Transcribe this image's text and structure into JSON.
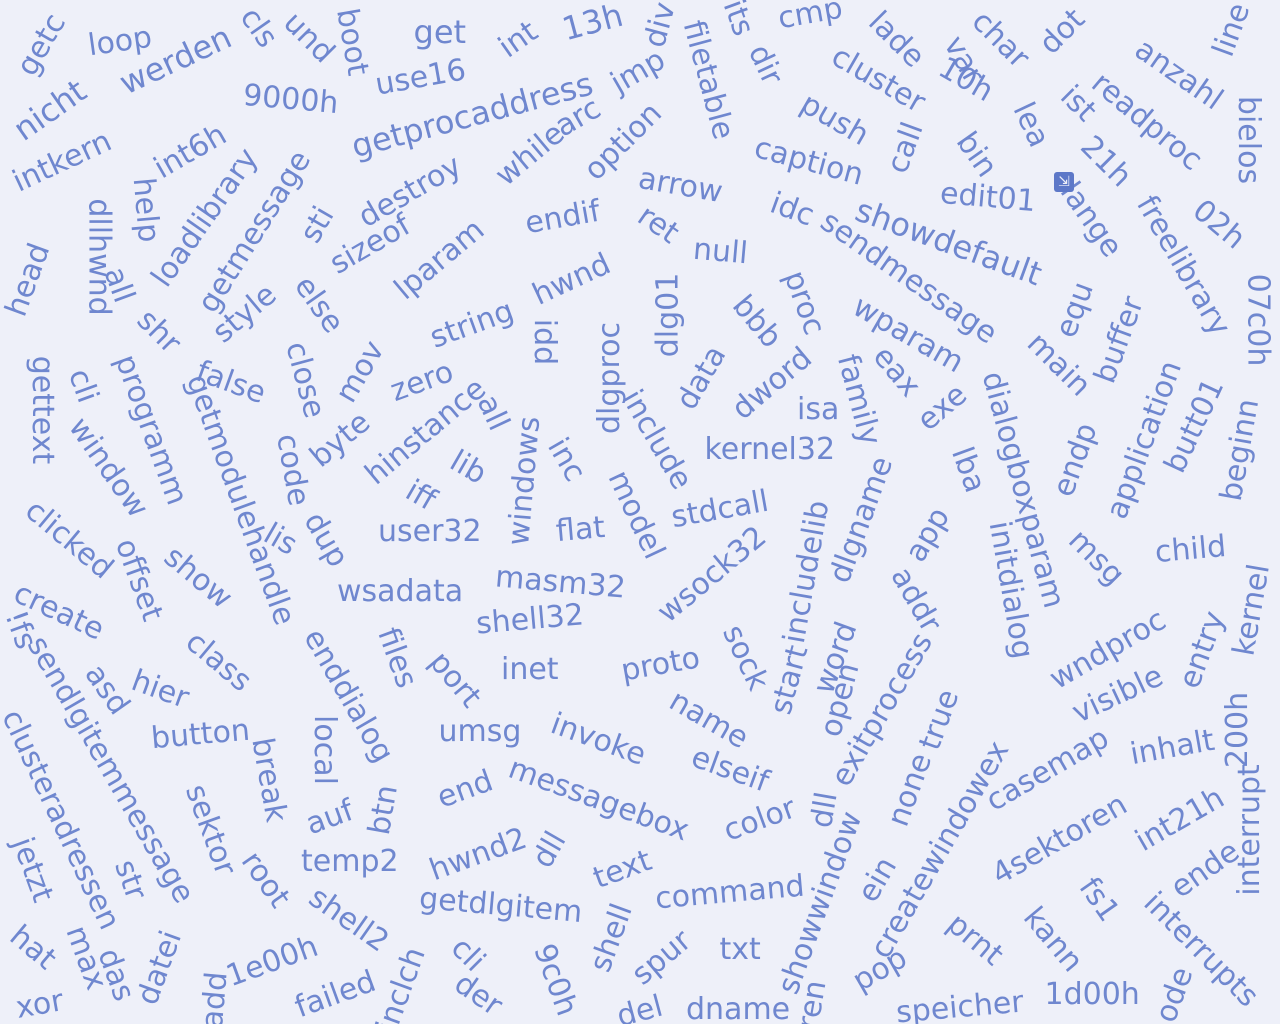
{
  "word_cloud": {
    "color": "#6f87cf",
    "background": "#eef0f9",
    "words": [
      "getc",
      "nicht",
      "loop",
      "werden",
      "cls",
      "und",
      "boot",
      "get",
      "int",
      "13h",
      "div",
      "filetable",
      "its",
      "cmp",
      "lade",
      "var",
      "char",
      "dot",
      "anzahl",
      "line",
      "intkern",
      "int6h",
      "9000h",
      "use16",
      "getprocaddress",
      "jmp",
      "dir",
      "cluster",
      "10h",
      "lea",
      "ist",
      "readproc",
      "bielos",
      "help",
      "loadlibrary",
      "getmessage",
      "sti",
      "destroy",
      "while",
      "arc",
      "option",
      "caption",
      "push",
      "call",
      "bin",
      "21h",
      "freelibrary",
      "02h",
      "head",
      "dllhwnd",
      "all",
      "sizeof",
      "lparam",
      "endif",
      "arrow",
      "ret",
      "null",
      "idc",
      "showdefault",
      "edit01",
      "lange",
      "07c0h",
      "shr",
      "style",
      "else",
      "string",
      "hwnd",
      "sendmessage",
      "equ",
      "buffer",
      "main",
      "gettext",
      "cli",
      "programm",
      "false",
      "close",
      "mov",
      "zero",
      "idd",
      "dlgproc",
      "dlg01",
      "bbb",
      "proc",
      "wparam",
      "eax",
      "family",
      "exe",
      "window",
      "getmodulehandle",
      "code",
      "byte",
      "hinstance",
      "all",
      "lib",
      "windows",
      "inc",
      "include",
      "data",
      "dword",
      "isa",
      "kernel32",
      "dialogboxparam",
      "endp",
      "application",
      "butt01",
      "beginn",
      "clicked",
      "offset",
      "show",
      "lis",
      "dup",
      "iff",
      "user32",
      "flat",
      "model",
      "stdcall",
      "includelib",
      "dlgname",
      "lba",
      "app",
      "initdialog",
      "msg",
      "child",
      "create",
      "wsadata",
      "masm32",
      "wsock32",
      "shell32",
      "class",
      "hier",
      "asd",
      "!fs",
      "enddialog",
      "files",
      "port",
      "inet",
      "proto",
      "sock",
      "start",
      "word",
      "open",
      "addr",
      "wndproc",
      "entry",
      "kernel",
      "sendlgitemmessage",
      "clusteradressen",
      "button",
      "break",
      "local",
      "umsg",
      "invoke",
      "name",
      "elseif",
      "exitprocess",
      "true",
      "visible",
      "inhalt",
      "200h",
      "sektor",
      "auf",
      "btn",
      "end",
      "messagebox",
      "color",
      "dll",
      "none",
      "createwindowex",
      "casemap",
      "4sektoren",
      "int21h",
      "interrupt",
      "jetzt",
      "str",
      "root",
      "temp2",
      "hwnd2",
      "dll",
      "text",
      "command",
      "showwindow",
      "ein",
      "ende",
      "fs1",
      "interrupts",
      "hat",
      "max",
      "das",
      "datei",
      "1e00h",
      "shell2",
      "getdlgitem",
      "shell",
      "spur",
      "txt",
      "pop",
      "prnt",
      "kann",
      "ode",
      "xor",
      "add",
      "failed",
      "inclch",
      "cli",
      "der",
      "9c0h",
      "del",
      "dname",
      "ren",
      "speicher",
      "1d00h"
    ]
  }
}
